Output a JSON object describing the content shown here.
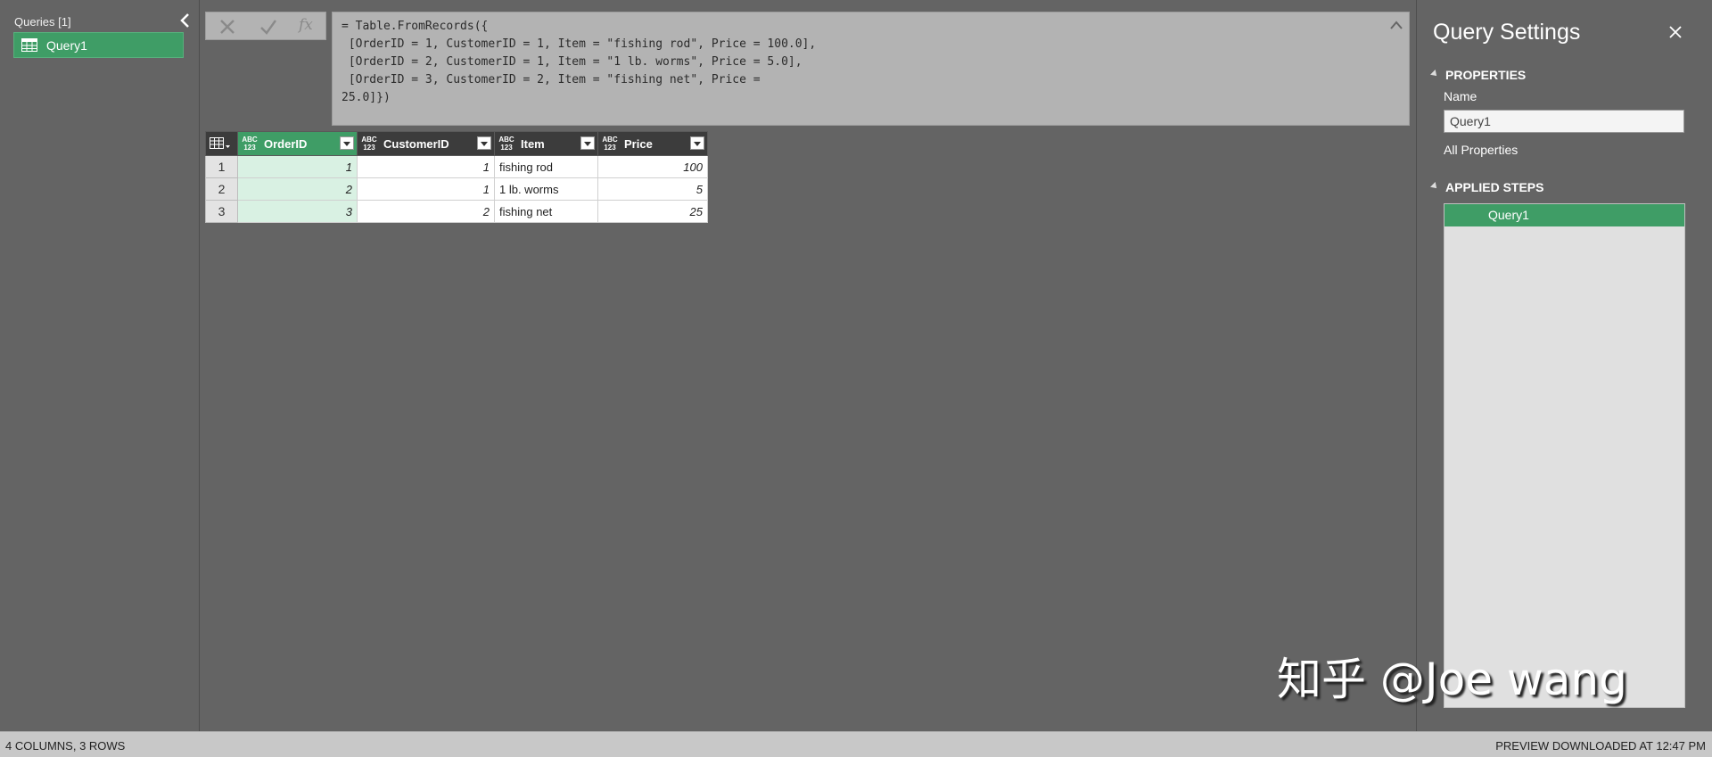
{
  "queries_pane": {
    "header": "Queries [1]",
    "items": [
      {
        "label": "Query1"
      }
    ]
  },
  "formula_bar": {
    "fx": "fx",
    "text": "= Table.FromRecords({\n [OrderID = 1, CustomerID = 1, Item = \"fishing rod\", Price = 100.0],\n [OrderID = 2, CustomerID = 1, Item = \"1 lb. worms\", Price = 5.0],\n [OrderID = 3, CustomerID = 2, Item = \"fishing net\", Price =\n25.0]})"
  },
  "grid": {
    "columns": [
      {
        "type_top": "ABC",
        "type_bottom": "123",
        "label": "OrderID"
      },
      {
        "type_top": "ABC",
        "type_bottom": "123",
        "label": "CustomerID"
      },
      {
        "type_top": "ABC",
        "type_bottom": "123",
        "label": "Item"
      },
      {
        "type_top": "ABC",
        "type_bottom": "123",
        "label": "Price"
      }
    ],
    "rows": [
      {
        "n": "1",
        "cells": [
          "1",
          "1",
          "fishing rod",
          "100"
        ]
      },
      {
        "n": "2",
        "cells": [
          "2",
          "1",
          "1 lb. worms",
          "5"
        ]
      },
      {
        "n": "3",
        "cells": [
          "3",
          "2",
          "fishing net",
          "25"
        ]
      }
    ]
  },
  "settings": {
    "title": "Query Settings",
    "properties_header": "PROPERTIES",
    "name_label": "Name",
    "name_value": "Query1",
    "all_properties": "All Properties",
    "applied_steps_header": "APPLIED STEPS",
    "steps": [
      {
        "label": "Query1"
      }
    ]
  },
  "watermark": "知乎 @Joe wang",
  "status": {
    "left": "4 COLUMNS, 3 ROWS",
    "right": "PREVIEW DOWNLOADED AT 12:47 PM"
  },
  "colors": {
    "accent": "#3f9d66",
    "selected_cell": "#d9f1e3",
    "background": "#646464"
  }
}
